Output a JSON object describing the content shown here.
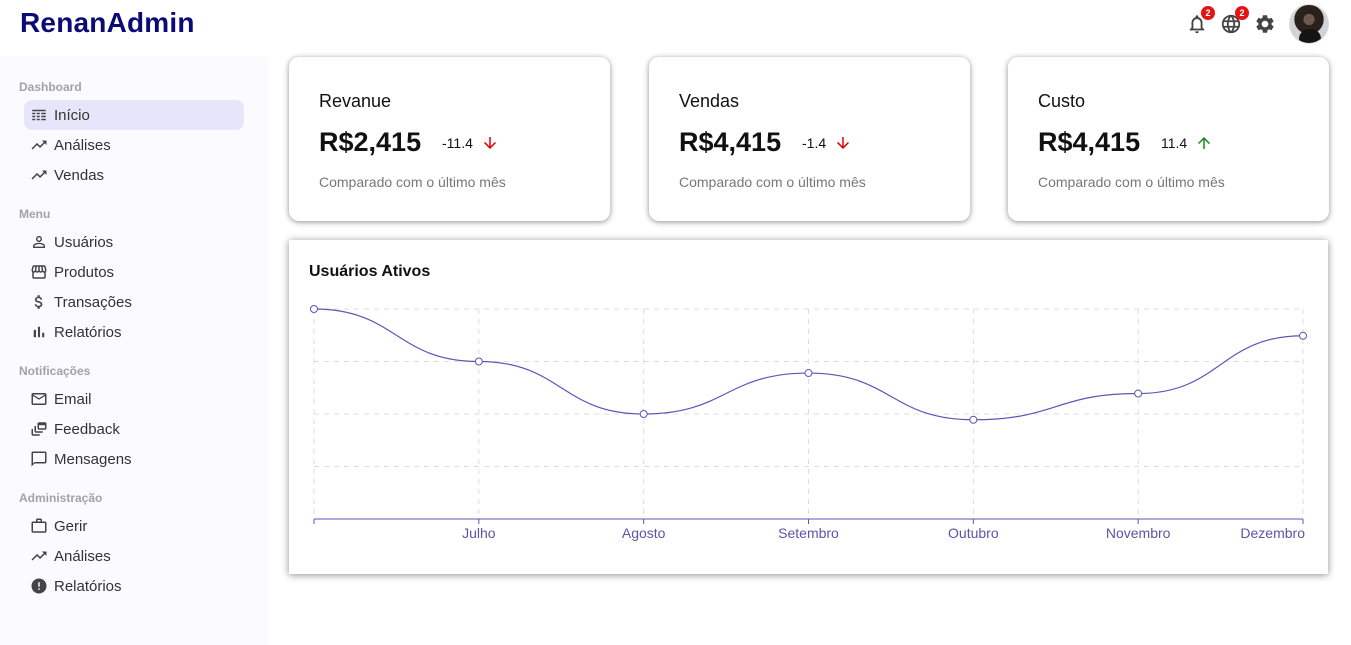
{
  "app": {
    "title": "RenanAdmin"
  },
  "topbar": {
    "notifications_badge": "2",
    "language_badge": "2"
  },
  "sidebar": {
    "sections": [
      {
        "title": "Dashboard",
        "items": [
          {
            "label": "Início",
            "icon": "dashboard-icon",
            "active": true
          },
          {
            "label": "Análises",
            "icon": "trending-up-icon"
          },
          {
            "label": "Vendas",
            "icon": "trending-up-icon"
          }
        ]
      },
      {
        "title": "Menu",
        "items": [
          {
            "label": "Usuários",
            "icon": "person-icon"
          },
          {
            "label": "Produtos",
            "icon": "storefront-icon"
          },
          {
            "label": "Transações",
            "icon": "dollar-icon"
          },
          {
            "label": "Relatórios",
            "icon": "bar-chart-icon"
          }
        ]
      },
      {
        "title": "Notificações",
        "items": [
          {
            "label": "Email",
            "icon": "mail-icon"
          },
          {
            "label": "Feedback",
            "icon": "dynamic-feed-icon"
          },
          {
            "label": "Mensagens",
            "icon": "chat-bubble-icon"
          }
        ]
      },
      {
        "title": "Administração",
        "items": [
          {
            "label": "Gerir",
            "icon": "briefcase-icon"
          },
          {
            "label": "Análises",
            "icon": "trending-up-icon"
          },
          {
            "label": "Relatórios",
            "icon": "report-icon"
          }
        ]
      }
    ]
  },
  "cards": [
    {
      "title": "Revanue",
      "value": "R$2,415",
      "rate": "-11.4",
      "direction": "down",
      "subtitle": "Comparado com o último mês"
    },
    {
      "title": "Vendas",
      "value": "R$4,415",
      "rate": "-1.4",
      "direction": "down",
      "subtitle": "Comparado com o último mês"
    },
    {
      "title": "Custo",
      "value": "R$4,415",
      "rate": "11.4",
      "direction": "up",
      "subtitle": "Comparado com o último mês"
    }
  ],
  "colors": {
    "brand": "#0a0a78",
    "line": "#5a56b8",
    "down": "#e00000",
    "up": "#1a8a1a",
    "active_bg": "#e6e6fb"
  },
  "chart_data": {
    "type": "line",
    "title": "Usuários Ativos",
    "x": [
      "",
      "Julho",
      "Agosto",
      "Setembro",
      "Outubro",
      "Novembro",
      "Dezembro"
    ],
    "series": [
      {
        "values": [
          4000,
          3000,
          2000,
          2780,
          1890,
          2390,
          3490
        ]
      }
    ],
    "ylim": [
      0,
      4000
    ],
    "grid": true
  }
}
